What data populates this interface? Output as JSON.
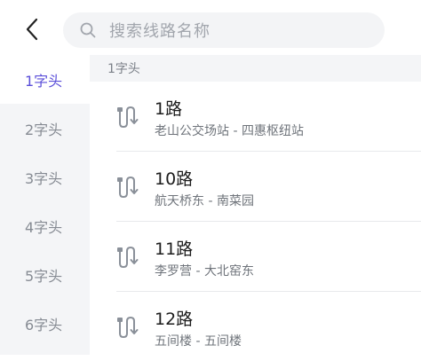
{
  "header": {
    "back_icon": "chevron-left-icon",
    "search": {
      "icon": "search-icon",
      "placeholder": "搜索线路名称"
    }
  },
  "sidebar": {
    "items": [
      {
        "label": "1字头",
        "active": true
      },
      {
        "label": "2字头",
        "active": false
      },
      {
        "label": "3字头",
        "active": false
      },
      {
        "label": "4字头",
        "active": false
      },
      {
        "label": "5字头",
        "active": false
      },
      {
        "label": "6字头",
        "active": false
      }
    ]
  },
  "main": {
    "section_title": "1字头",
    "routes": [
      {
        "name": "1路",
        "stops": "老山公交场站 - 四惠枢纽站",
        "icon": "route-icon"
      },
      {
        "name": "10路",
        "stops": "航天桥东 - 南菜园",
        "icon": "route-icon"
      },
      {
        "name": "11路",
        "stops": "李罗营 - 大北窑东",
        "icon": "route-icon"
      },
      {
        "name": "12路",
        "stops": "五间楼 - 五间楼",
        "icon": "route-icon"
      }
    ]
  },
  "colors": {
    "accent": "#5b4fd9",
    "sidebar_bg": "#f4f5f7",
    "search_bg": "#f3f4f6",
    "icon_gray": "#8a9099"
  }
}
